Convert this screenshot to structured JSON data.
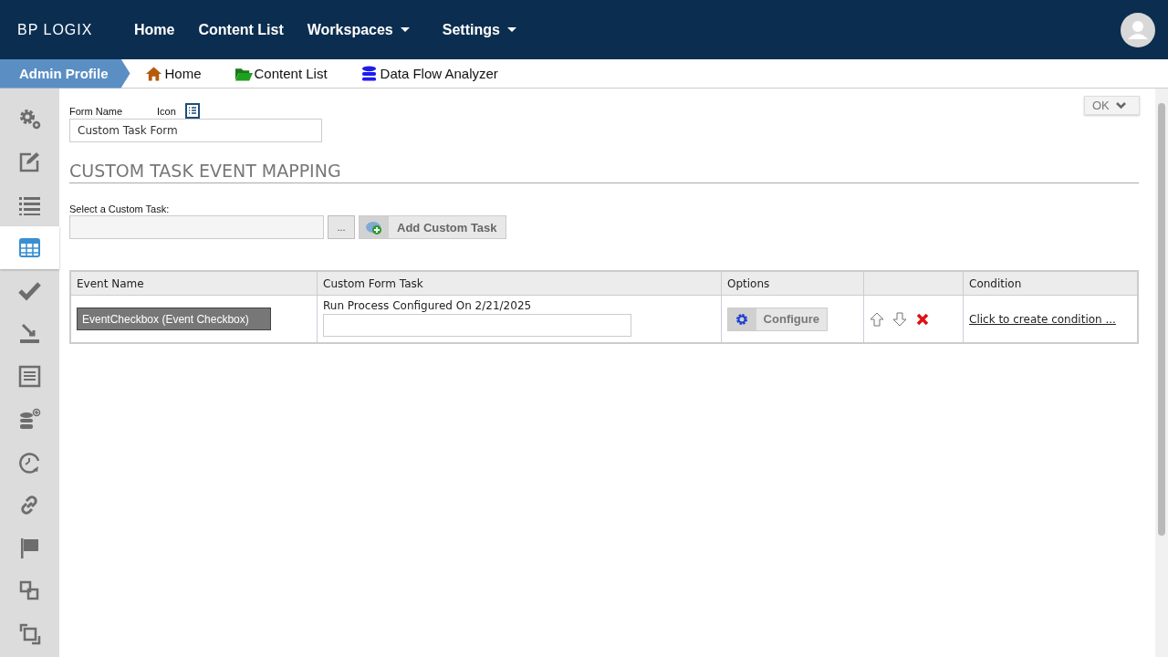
{
  "logo": {
    "text": "BP LOGIX"
  },
  "nav": [
    {
      "label": "Home",
      "dropdown": false
    },
    {
      "label": "Content List",
      "dropdown": false
    },
    {
      "label": "Workspaces",
      "dropdown": true
    },
    {
      "label": "Settings",
      "dropdown": true
    }
  ],
  "breadcrumb": {
    "profile": "Admin Profile",
    "links": [
      {
        "kind": "home",
        "label": "Home"
      },
      {
        "kind": "folder",
        "label": "Content List"
      },
      {
        "kind": "database",
        "label": "Data Flow Analyzer"
      }
    ]
  },
  "sidebar": {
    "items": [
      {
        "kind": "gears",
        "selected": false
      },
      {
        "kind": "edit",
        "selected": false
      },
      {
        "kind": "list",
        "selected": false
      },
      {
        "kind": "table",
        "selected": true
      },
      {
        "kind": "check",
        "selected": false
      },
      {
        "kind": "import",
        "selected": false
      },
      {
        "kind": "form",
        "selected": false
      },
      {
        "kind": "dbadd",
        "selected": false
      },
      {
        "kind": "clock",
        "selected": false
      },
      {
        "kind": "link",
        "selected": false
      },
      {
        "kind": "flag",
        "selected": false
      },
      {
        "kind": "copy",
        "selected": false
      },
      {
        "kind": "copy2",
        "selected": false
      }
    ]
  },
  "ok_button": "OK",
  "form_name": {
    "label": "Form Name",
    "icon_label": "Icon",
    "value": "Custom Task Form"
  },
  "heading": "CUSTOM TASK EVENT MAPPING",
  "select_task": {
    "label": "Select a Custom Task:",
    "browse": "...",
    "add_button": "Add Custom Task"
  },
  "table": {
    "columns": [
      "Event Name",
      "Custom Form Task",
      "Options",
      "",
      "Condition"
    ],
    "rows": [
      {
        "event": "EventCheckbox (Event Checkbox)",
        "task_note": "Run Process Configured On 2/21/2025",
        "configure": "Configure",
        "condition": "Click to create condition ..."
      }
    ]
  }
}
